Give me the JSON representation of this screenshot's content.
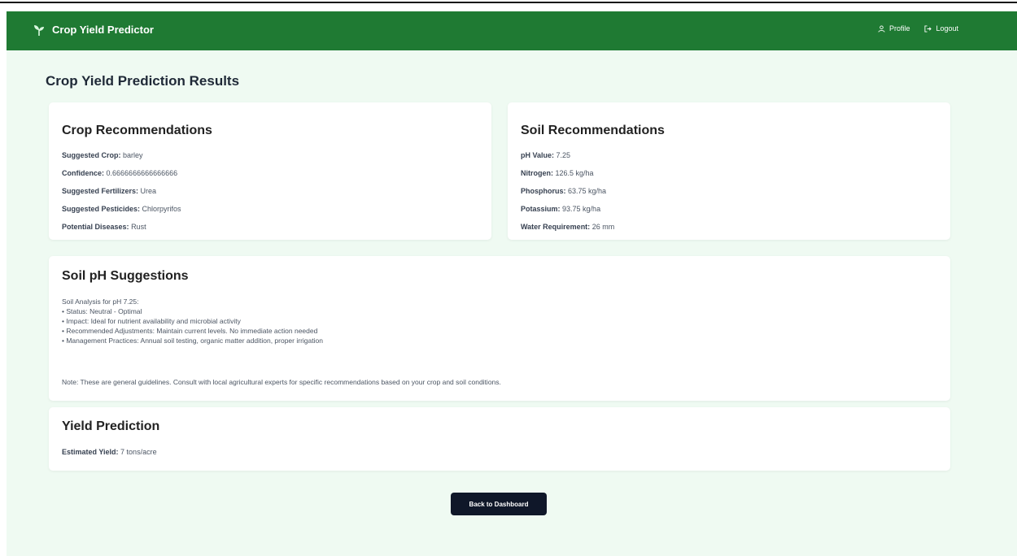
{
  "navbar": {
    "brand": "Crop Yield Predictor",
    "brand_icon": "sprout-icon",
    "links": [
      {
        "label": "Profile",
        "icon": "user-icon"
      },
      {
        "label": "Logout",
        "icon": "logout-icon"
      }
    ]
  },
  "page": {
    "title": "Crop Yield Prediction Results"
  },
  "crop_recommendations": {
    "title": "Crop Recommendations",
    "items": [
      {
        "key": "Suggested Crop:",
        "value": "barley"
      },
      {
        "key": "Confidence:",
        "value": "0.6666666666666666"
      },
      {
        "key": "Suggested Fertilizers:",
        "value": "Urea"
      },
      {
        "key": "Suggested Pesticides:",
        "value": "Chlorpyrifos"
      },
      {
        "key": "Potential Diseases:",
        "value": "Rust"
      }
    ]
  },
  "soil_recommendations": {
    "title": "Soil Recommendations",
    "items": [
      {
        "key": "pH Value:",
        "value": "7.25"
      },
      {
        "key": "Nitrogen:",
        "value": "126.5 kg/ha"
      },
      {
        "key": "Phosphorus:",
        "value": "63.75 kg/ha"
      },
      {
        "key": "Potassium:",
        "value": "93.75 kg/ha"
      },
      {
        "key": "Water Requirement:",
        "value": "26 mm"
      }
    ]
  },
  "soil_ph": {
    "title": "Soil pH Suggestions",
    "lines": [
      "Soil Analysis for pH 7.25:",
      "• Status: Neutral - Optimal",
      "• Impact: Ideal for nutrient availability and microbial activity",
      "• Recommended Adjustments: Maintain current levels. No immediate action needed",
      "• Management Practices: Annual soil testing, organic matter addition, proper irrigation"
    ],
    "note": "Note: These are general guidelines. Consult with local agricultural experts for specific recommendations based on your crop and soil conditions."
  },
  "yield": {
    "title": "Yield Prediction",
    "key": "Estimated Yield:",
    "value": "7 tons/acre"
  },
  "actions": {
    "back_label": "Back to Dashboard"
  },
  "colors": {
    "navbar": "#1f7a33",
    "page_bg": "#effaf2",
    "card_bg": "#ffffff",
    "button_bg": "#0f1729"
  }
}
